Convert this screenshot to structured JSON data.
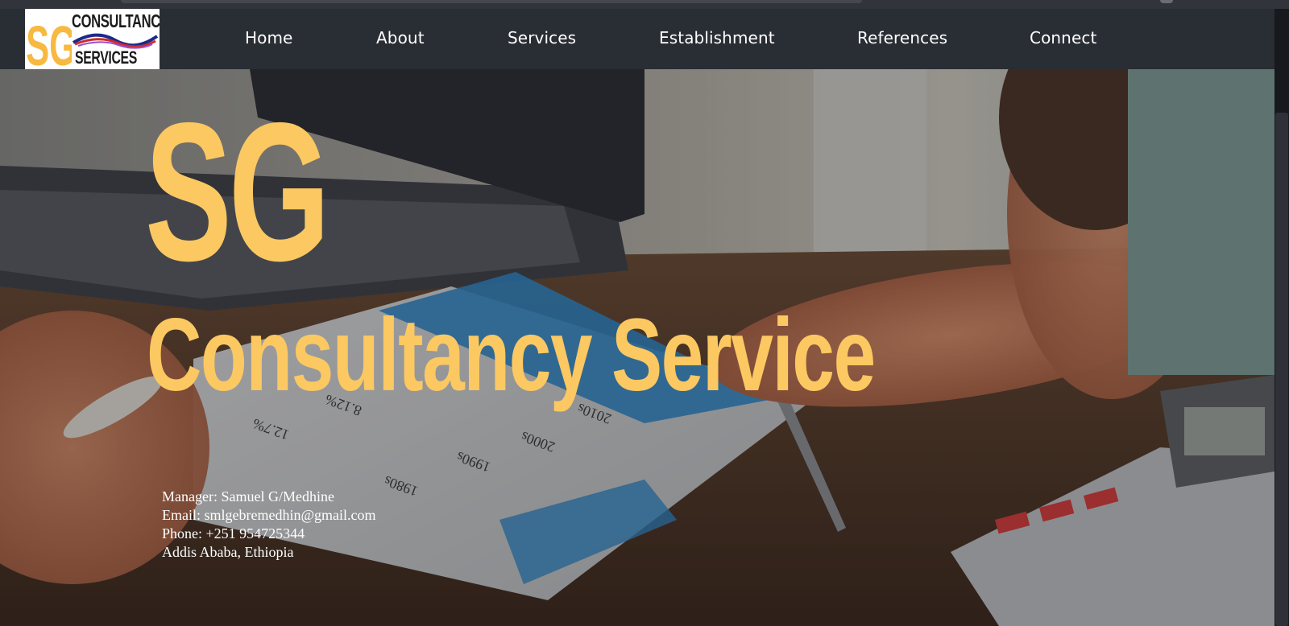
{
  "logo": {
    "letters": "SG",
    "line1": "CONSULTANCY",
    "line2": "SERVICES"
  },
  "nav": {
    "items": [
      {
        "label": "Home"
      },
      {
        "label": "About"
      },
      {
        "label": "Services"
      },
      {
        "label": "Establishment"
      },
      {
        "label": "References"
      },
      {
        "label": "Connect"
      }
    ]
  },
  "hero": {
    "big_letters": "SG",
    "title": "Consultancy Service",
    "contact": {
      "manager": "Manager: Samuel G/Medhine",
      "email": "Email: smlgebremedhin@gmail.com",
      "phone": "Phone: +251 954725344",
      "location": "Addis Ababa, Ethiopia"
    },
    "background_doc_text": {
      "r1": "2010s",
      "r2": "2000s",
      "r3": "1990s",
      "r4": "1980s",
      "p1": "8.12%",
      "p2": "12.7%"
    }
  },
  "colors": {
    "accent": "#fbc862",
    "navbar": "#292d34",
    "text_light": "#ffffff"
  }
}
